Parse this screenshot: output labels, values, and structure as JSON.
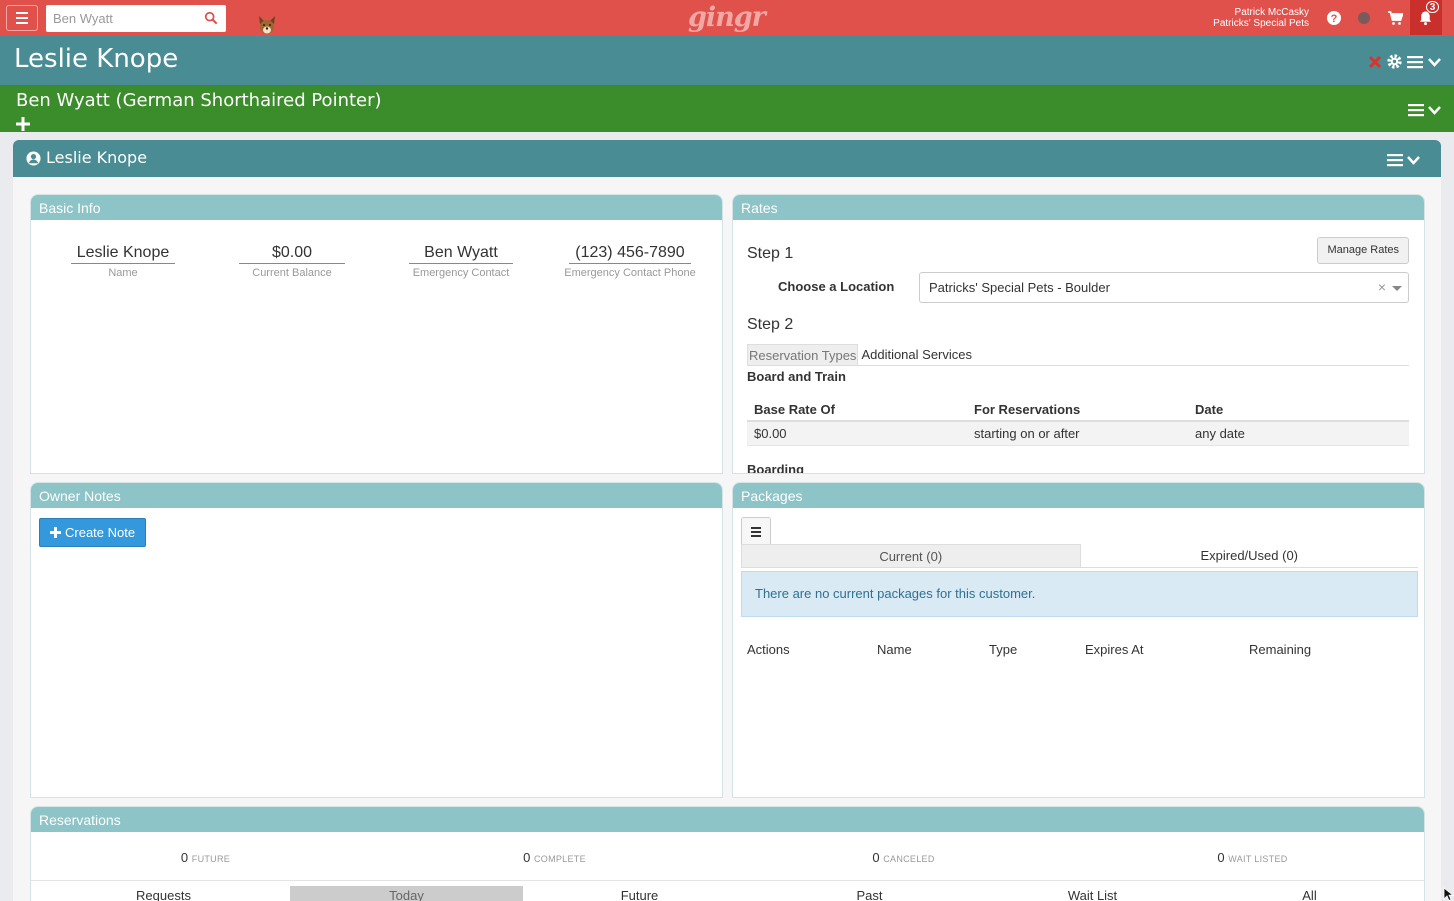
{
  "topbar": {
    "search_placeholder": "Ben Wyatt",
    "logo": "gingr",
    "user_name": "Patrick McCasky",
    "business_name": "Patricks' Special Pets",
    "notification_count": "3"
  },
  "customer": {
    "name": "Leslie Knope"
  },
  "pet": {
    "title": "Ben Wyatt (German Shorthaired Pointer)"
  },
  "main_panel": {
    "title": "Leslie Knope"
  },
  "basic_info": {
    "heading": "Basic Info",
    "fields": [
      {
        "value": "Leslie Knope",
        "label": "Name"
      },
      {
        "value": "$0.00",
        "label": "Current Balance"
      },
      {
        "value": "Ben Wyatt",
        "label": "Emergency Contact"
      },
      {
        "value": "(123) 456-7890",
        "label": "Emergency Contact Phone"
      }
    ]
  },
  "rates": {
    "heading": "Rates",
    "manage_button": "Manage Rates",
    "step1": "Step 1",
    "choose_location_label": "Choose a Location",
    "location_value": "Patricks' Special Pets - Boulder",
    "step2": "Step 2",
    "tabs": [
      "Reservation Types",
      "Additional Services"
    ],
    "group1": "Board and Train",
    "columns": [
      "Base Rate Of",
      "For Reservations",
      "Date"
    ],
    "rows": [
      [
        "$0.00",
        "starting on or after",
        "any date"
      ]
    ],
    "group2": "Boarding"
  },
  "owner_notes": {
    "heading": "Owner Notes",
    "create_button": "Create Note"
  },
  "packages": {
    "heading": "Packages",
    "tabs": [
      "Current (0)",
      "Expired/Used (0)"
    ],
    "alert": "There are no current packages for this customer.",
    "columns": [
      "Actions",
      "Name",
      "Type",
      "Expires At",
      "Remaining"
    ]
  },
  "reservations": {
    "heading": "Reservations",
    "counts": [
      {
        "num": "0",
        "label": "FUTURE"
      },
      {
        "num": "0",
        "label": "COMPLETE"
      },
      {
        "num": "0",
        "label": "CANCELED"
      },
      {
        "num": "0",
        "label": "WAIT LISTED"
      }
    ],
    "tabs": [
      "Requests",
      "Today",
      "Future",
      "Past",
      "Wait List",
      "All"
    ],
    "active_tab": "Today"
  },
  "colors": {
    "topbar": "#e0514c",
    "customer_header": "#4a8c94",
    "pet_bar": "#3b8c2a",
    "card_header": "#8cc4c8",
    "primary_button": "#3398dc"
  }
}
